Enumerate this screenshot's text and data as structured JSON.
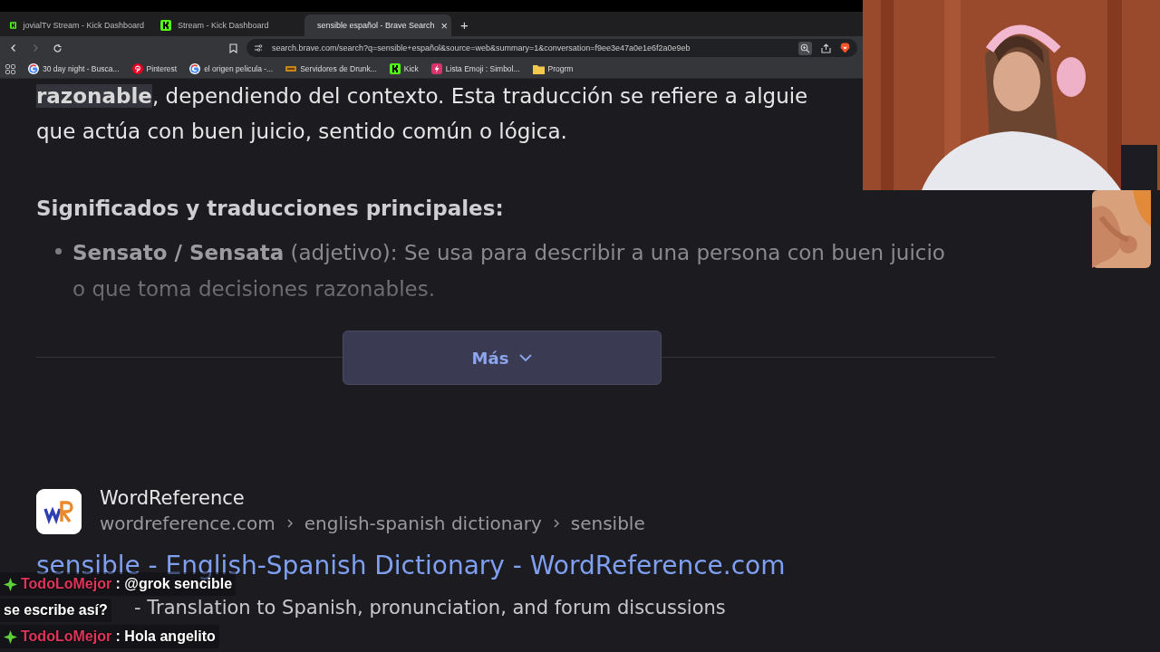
{
  "tabs": [
    {
      "kind": "kick",
      "label": "jovialTv Stream - Kick Dashboard",
      "selected": false
    },
    {
      "kind": "kick",
      "label": "Stream - Kick Dashboard",
      "selected": false
    },
    {
      "kind": "brave",
      "label": "sensible español - Brave Search",
      "selected": true
    }
  ],
  "tab_close": "×",
  "new_tab": "+",
  "toolbar": {
    "forward_disabled": true,
    "url": "search.brave.com/search?q=sensible+español&source=web&summary=1&conversation=f9ee3e47a0e1e6f2a0e9eb"
  },
  "bookmarks": [
    {
      "kind": "google",
      "label": "30 day night - Busca..."
    },
    {
      "kind": "pinterest",
      "label": "Pinterest"
    },
    {
      "kind": "google",
      "label": "el origen pelicula -..."
    },
    {
      "kind": "server",
      "label": "Servidores de Drunk..."
    },
    {
      "kind": "kick",
      "label": "Kick"
    },
    {
      "kind": "emoji",
      "label": "Lista Emoji : Simbol..."
    },
    {
      "kind": "folder",
      "label": "Progrm"
    }
  ],
  "answer": {
    "lines": [
      "**razonable**, dependiendo del contexto. Esta traducción se refiere a alguie",
      "que actúa con buen juicio, sentido común o lógica."
    ],
    "heading": "Significados y traducciones principales:",
    "bullets": [
      "**Sensato / Sensata** (adjetivo): Se usa para describir a una persona con buen juicio o que toma decisiones razonables."
    ],
    "more_button": "Más"
  },
  "result": {
    "site_name": "WordReference",
    "breadcrumb": [
      "wordreference.com",
      "english-spanish dictionary",
      "sensible"
    ],
    "title": "sensible - English-Spanish Dictionary - WordReference.com",
    "description": "- Translation to Spanish, pronunciation, and forum discussions"
  },
  "chat": [
    {
      "user": "TodoLoMejor",
      "separator": ":",
      "lines": [
        "@grok sencible",
        "se escribe así?"
      ]
    },
    {
      "user": "TodoLoMejor",
      "separator": ":",
      "lines": [
        "Hola angelito"
      ]
    }
  ]
}
